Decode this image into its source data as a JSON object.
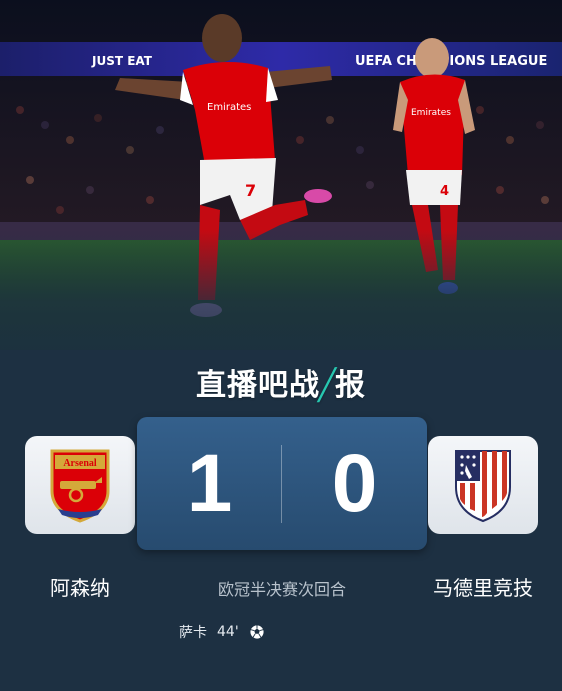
{
  "banner": {
    "sponsor": "JUST EAT",
    "competition": "UEFA CHAMPIONS LEAGUE"
  },
  "players": {
    "left_number": "7",
    "right_number": "4",
    "shirt_sponsor": "Emirates"
  },
  "brand": {
    "prefix": "直播吧战",
    "slash": "╱",
    "suffix": "报"
  },
  "match": {
    "home_team": "阿森纳",
    "away_team": "马德里竞技",
    "home_score": "1",
    "away_score": "0",
    "round": "欧冠半决赛次回合"
  },
  "home_crest": {
    "text": "Arsenal"
  },
  "scorer": {
    "name": "萨卡",
    "minute": "44'",
    "icon": "soccer-ball-icon"
  },
  "colors": {
    "background": "#1d3042",
    "score_panel": "#2f5a84",
    "arsenal_red": "#db0007",
    "atletico_red": "#cb3524",
    "atletico_blue": "#262e62",
    "accent_teal": "#27c7b0"
  }
}
